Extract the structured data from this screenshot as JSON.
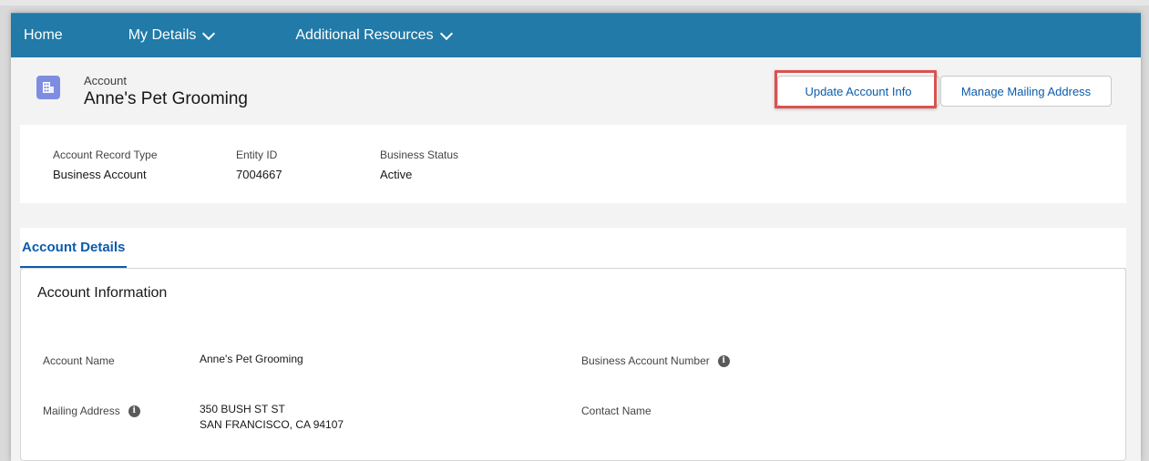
{
  "nav": {
    "home": "Home",
    "my_details": "My Details",
    "additional_resources": "Additional Resources"
  },
  "header": {
    "object_label": "Account",
    "record_name": "Anne's Pet Grooming",
    "update_button": "Update Account Info",
    "mailing_button": "Manage Mailing Address"
  },
  "highlights": [
    {
      "label": "Account Record Type",
      "value": "Business Account"
    },
    {
      "label": "Entity ID",
      "value": "7004667"
    },
    {
      "label": "Business Status",
      "value": "Active"
    }
  ],
  "tabs": {
    "active": "Account Details"
  },
  "account_info": {
    "section_title": "Account Information",
    "account_name_label": "Account Name",
    "account_name_value": "Anne's Pet Grooming",
    "business_account_number_label": "Business Account Number",
    "mailing_address_label": "Mailing Address",
    "mailing_address_line1": "350 BUSH ST ST",
    "mailing_address_line2": "SAN FRANCISCO, CA 94107",
    "contact_name_label": "Contact Name"
  },
  "colors": {
    "nav_bg": "#217aa7",
    "link_blue": "#0b5cab",
    "highlight_red": "#d9534f",
    "account_icon": "#7f8de1"
  },
  "icons": {
    "account": "building-icon",
    "info": "info-icon",
    "chevron": "chevron-down-icon"
  }
}
